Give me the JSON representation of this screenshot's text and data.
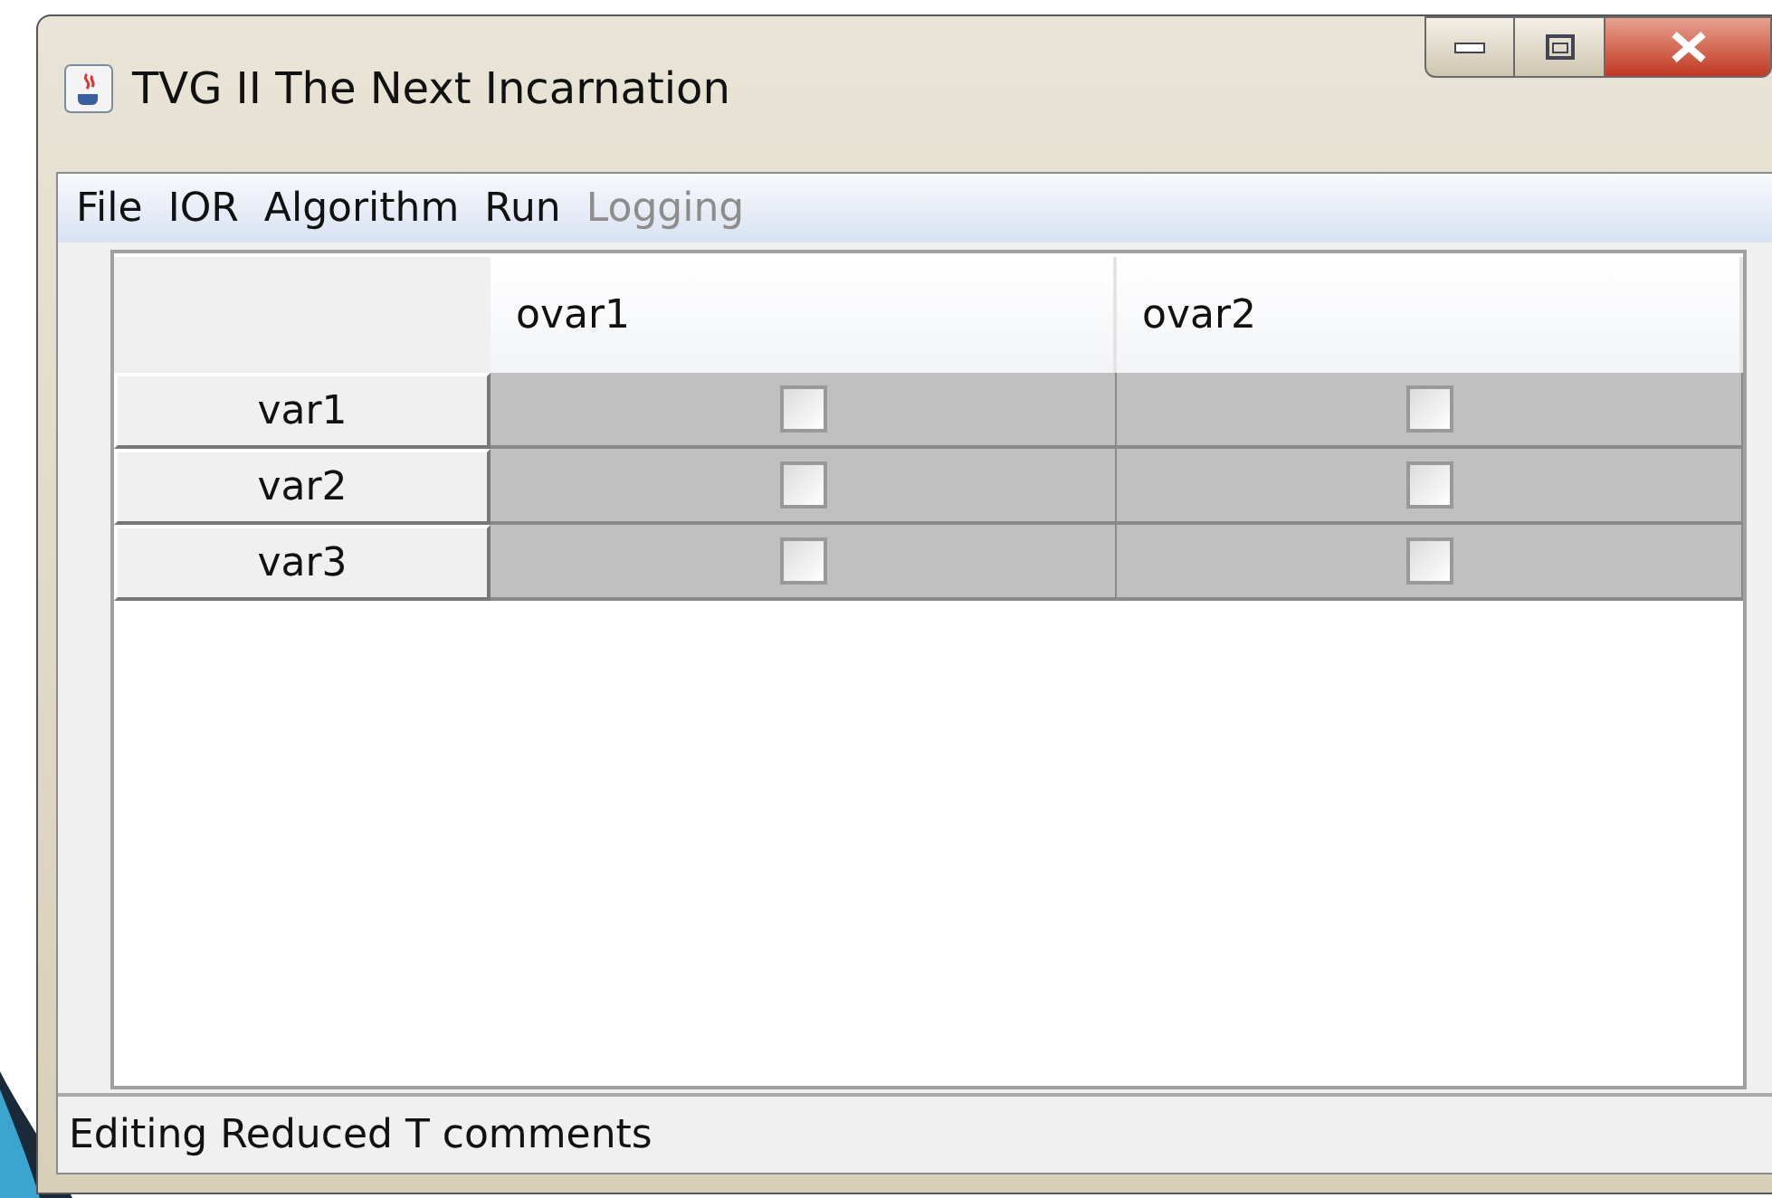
{
  "window": {
    "title": "TVG II The Next Incarnation"
  },
  "menu": [
    {
      "label": "File",
      "disabled": false
    },
    {
      "label": "IOR",
      "disabled": false
    },
    {
      "label": "Algorithm",
      "disabled": false
    },
    {
      "label": "Run",
      "disabled": false
    },
    {
      "label": "Logging",
      "disabled": true
    }
  ],
  "table": {
    "columns": [
      "ovar1",
      "ovar2"
    ],
    "rows": [
      {
        "name": "var1",
        "cells": [
          {
            "checked": false
          },
          {
            "checked": false
          }
        ]
      },
      {
        "name": "var2",
        "cells": [
          {
            "checked": false
          },
          {
            "checked": false
          }
        ]
      },
      {
        "name": "var3",
        "cells": [
          {
            "checked": false
          },
          {
            "checked": false
          }
        ]
      }
    ]
  },
  "status_bar": "Editing Reduced T comments"
}
